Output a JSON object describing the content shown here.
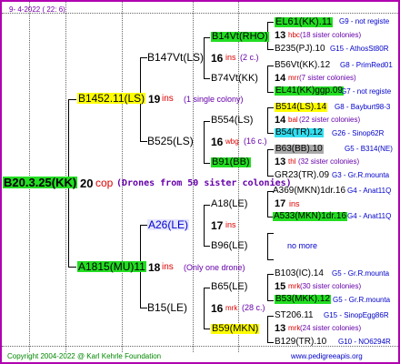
{
  "header": {
    "date": "9-  4-2022 ( 22:  6)"
  },
  "footer": {
    "copyright": "Copyright 2004-2022 @ Karl Kehrle Foundation",
    "site": "www.pedigreeapis.org"
  },
  "colors": {
    "border": "#b000b0",
    "green": "#22dd22",
    "yellow": "#ffff00",
    "cyan": "#33ddee",
    "gray": "#aaaaaa"
  },
  "root": {
    "id": "B20.3.25(KK)",
    "count": "20",
    "mark": "cop",
    "note": "(Drones from 50 sister colonies)"
  },
  "sire": {
    "id": "B1452.11(LS)",
    "count": "19",
    "mark": "ins",
    "note": "(1 single colony)",
    "father": {
      "id": "B147Vt(LS)",
      "count": "16",
      "mark": "ins",
      "note": "(2 c.)",
      "father": {
        "id": "B14Vt(RHO)",
        "gen": {
          "id": "EL61(KK).11",
          "code": "G9 - not registe",
          "count": "13",
          "mark": "hbc",
          "note": "(18 sister colonies)",
          "mother": "B235(PJ).10",
          "mcode": "G15 - AthosSt80R"
        }
      },
      "mother": {
        "id": "B74Vt(KK)",
        "gen": {
          "id": "B56Vt(KK).12",
          "code": "G8 - PrimRed01",
          "count": "14",
          "mark": "mrr",
          "note": "(7 sister colonies)",
          "mother": "EL41(KK)ggp.09",
          "mcode": "G7 - not registe"
        }
      }
    },
    "mother": {
      "id": "B525(LS)",
      "count": "16",
      "mark": "wbg",
      "note": "(16 c.)",
      "father": {
        "id": "B554(LS)",
        "gen": {
          "id": "B514(LS).14",
          "code": "G8 - Bayburt98-3",
          "count": "14",
          "mark": "bal",
          "note": "(22 sister colonies)",
          "mother": "B54(TR).12",
          "mcode": "G26 - Sinop62R"
        }
      },
      "mother": {
        "id": "B91(BB)",
        "gen": {
          "id": "B63(BB).10",
          "code": "G5 - B314(NE)",
          "count": "13",
          "mark": "thl",
          "note": "(32 sister colonies)",
          "mother": "GR23(TR).09",
          "mcode": "G3 - Gr.R.mounta"
        }
      }
    }
  },
  "dam": {
    "id": "A1815(MU)11",
    "count": "18",
    "mark": "ins",
    "note": "(Only one drone)",
    "father": {
      "id": "A26(LE)",
      "count": "17",
      "mark": "ins",
      "father": {
        "id": "A18(LE)",
        "gen": {
          "id": "A369(MKN)1dr.16",
          "code": "G4 - Anat11Q",
          "count": "17",
          "mark": "ins",
          "mother": "A533(MKN)1dr.16",
          "mcode": "G4 - Anat11Q"
        }
      },
      "mother": {
        "id": "B96(LE)",
        "nomore": "no more"
      }
    },
    "mother": {
      "id": "B15(LE)",
      "count": "16",
      "mark": "mrk",
      "note": "(28 c.)",
      "father": {
        "id": "B65(LE)",
        "gen": {
          "id": "B103(IC).14",
          "code": "G5 - Gr.R.mounta",
          "count": "15",
          "mark": "mrk",
          "note": "(30 sister colonies)",
          "mother": "B53(MKK).12",
          "mcode": "G5 - Gr.R.mounta"
        }
      },
      "mother": {
        "id": "B59(MKN)",
        "gen": {
          "id": "ST206.11",
          "code": "G15 - SinopEgg86R",
          "count": "13",
          "mark": "mrk",
          "note": "(24 sister colonies)",
          "mother": "B129(TR).10",
          "mcode": "G10 - NO6294R"
        }
      }
    }
  }
}
